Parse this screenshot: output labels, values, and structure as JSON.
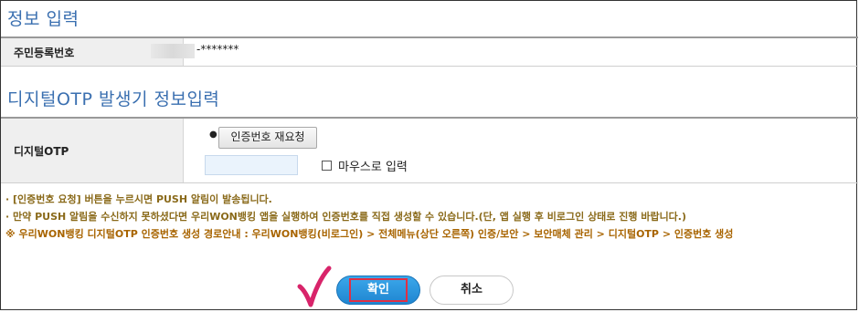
{
  "section1": {
    "title": "정보 입력",
    "rrn_label": "주민등록번호",
    "rrn_masked_tail": "-*******"
  },
  "section2": {
    "title": "디지털OTP 발생기 정보입력",
    "otp_label": "디지털OTP",
    "reissue_button": "인증번호 재요청",
    "otp_input_value": "",
    "mouse_input_label": "마우스로 입력",
    "mouse_input_checked": false
  },
  "notes": [
    "· [인증번호 요청] 버튼을 누르시면 PUSH 알림이 발송됩니다.",
    "· 만약 PUSH 알림을 수신하지 못하셨다면 우리WON뱅킹 앱을 실행하여 인증번호를 직접 생성할 수 있습니다.(단, 앱 실행 후 비로그인 상태로 진행 바랍니다.)",
    "※ 우리WON뱅킹 디지털OTP 인증번호 생성 경로안내 : 우리WON뱅킹(비로그인) > 전체메뉴(상단 오른쪽) 인증/보안 > 보안매체 관리 > 디지털OTP > 인증번호 생성"
  ],
  "buttons": {
    "confirm": "확인",
    "cancel": "취소"
  },
  "colors": {
    "section_title": "#3a6fb0",
    "confirm_button": "#1f86d1",
    "highlight_box": "#e03044",
    "checkmark": "#d8246a",
    "note_text": "#8a6a1a"
  },
  "icons": {
    "checkmark": "checkmark-annotation-icon",
    "bullet": "bullet-icon"
  }
}
